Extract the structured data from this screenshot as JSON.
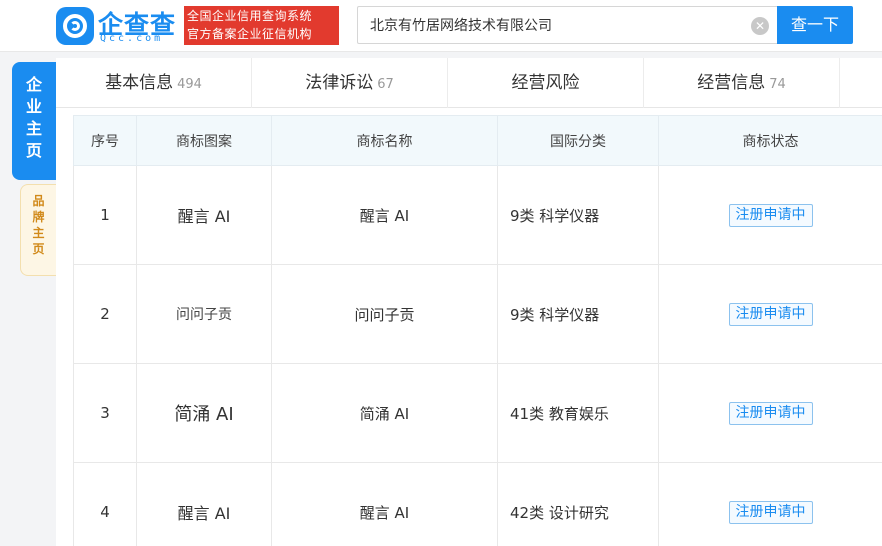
{
  "header": {
    "logo_text": "企查查",
    "logo_sub": "Qcc.com",
    "slogan_line1": "全国企业信用查询系统",
    "slogan_line2": "官方备案企业征信机构",
    "search_value": "北京有竹居网络技术有限公司",
    "clear_glyph": "✕",
    "search_button": "查一下"
  },
  "side_tabs": {
    "main": "企业主页",
    "brand": "品牌主页"
  },
  "tabs": [
    {
      "label": "基本信息",
      "count": "494"
    },
    {
      "label": "法律诉讼",
      "count": "67"
    },
    {
      "label": "经营风险",
      "count": ""
    },
    {
      "label": "经营信息",
      "count": "74"
    }
  ],
  "table": {
    "headers": [
      "序号",
      "商标图案",
      "商标名称",
      "国际分类",
      "商标状态"
    ],
    "rows": [
      {
        "no": "1",
        "image_text": "醒言 AI",
        "name": "醒言 AI",
        "class": "9类 科学仪器",
        "status": "注册申请中"
      },
      {
        "no": "2",
        "image_text": "问问子贡",
        "name": "问问子贡",
        "class": "9类 科学仪器",
        "status": "注册申请中"
      },
      {
        "no": "3",
        "image_text": "简涌 AI",
        "name": "简涌 AI",
        "class": "41类 教育娱乐",
        "status": "注册申请中"
      },
      {
        "no": "4",
        "image_text": "醒言 AI",
        "name": "醒言 AI",
        "class": "42类 设计研究",
        "status": "注册申请中"
      }
    ]
  },
  "colors": {
    "brand_blue": "#1a8cf0",
    "slogan_red": "#e23a2e",
    "brand_tab_orange": "#d18a1b"
  }
}
